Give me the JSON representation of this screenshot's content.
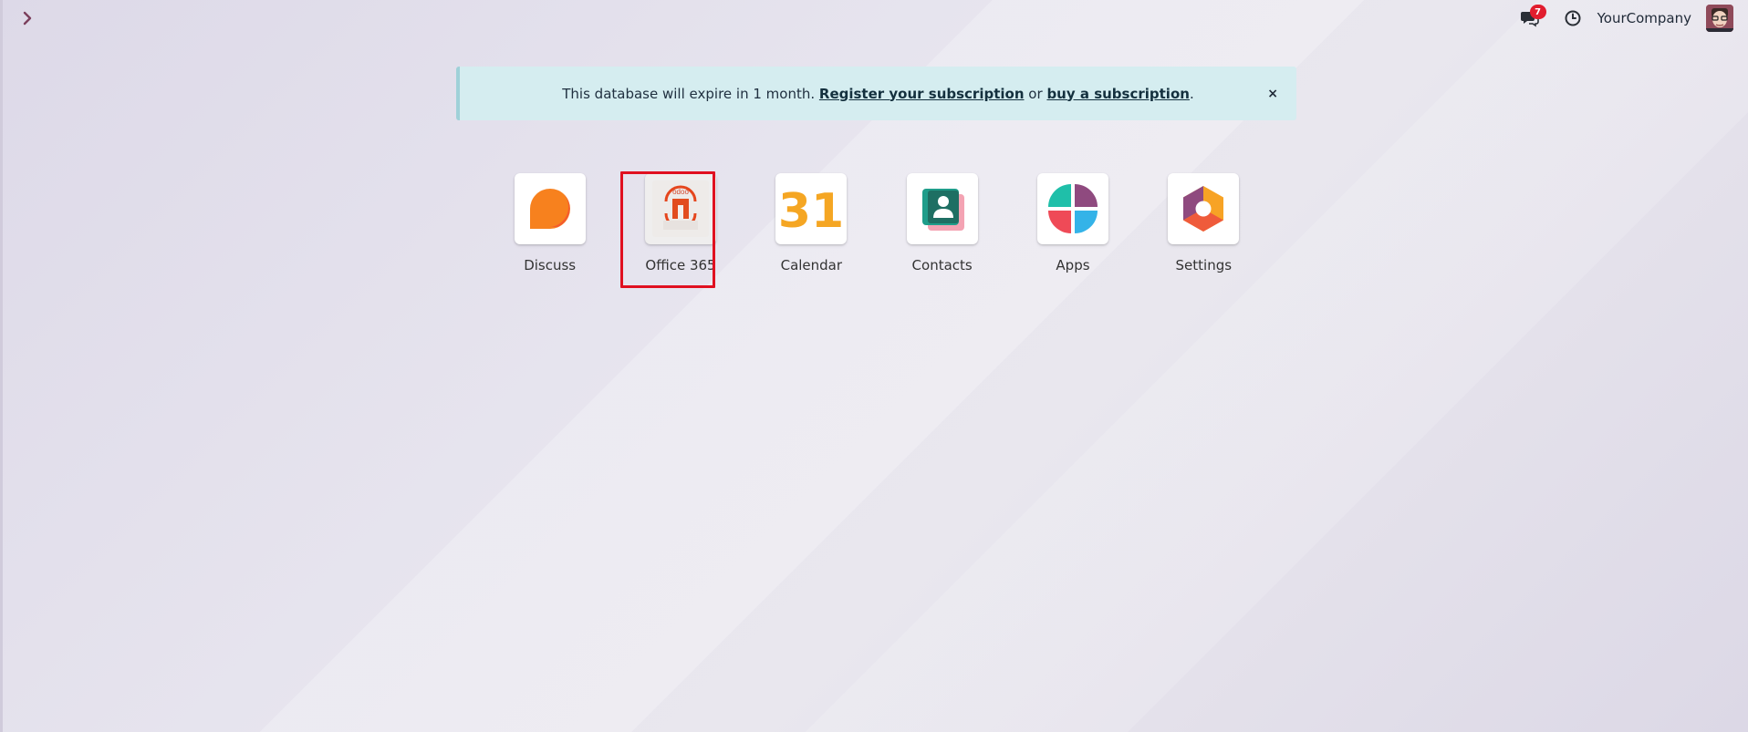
{
  "topbar": {
    "menu_icon": "chevron-right-icon",
    "chat_badge": "7",
    "company": "YourCompany"
  },
  "alert": {
    "text_before": "This database will expire in 1 month.",
    "link1": "Register your subscription",
    "text_mid": "or",
    "link2": "buy a subscription",
    "text_end": ".",
    "close": "×"
  },
  "apps": [
    {
      "label": "Discuss",
      "icon": "discuss-icon"
    },
    {
      "label": "Office 365",
      "icon": "office-365-icon",
      "selected": true,
      "logo_text": "odoo"
    },
    {
      "label": "Calendar",
      "icon": "calendar-icon",
      "glyph": "31"
    },
    {
      "label": "Contacts",
      "icon": "contacts-icon"
    },
    {
      "label": "Apps",
      "icon": "apps-icon"
    },
    {
      "label": "Settings",
      "icon": "settings-icon"
    }
  ],
  "colors": {
    "accent": "#7b3f5c",
    "badge": "#e11d2e",
    "alert_bg": "#d5edf0",
    "selection": "#e01020"
  }
}
